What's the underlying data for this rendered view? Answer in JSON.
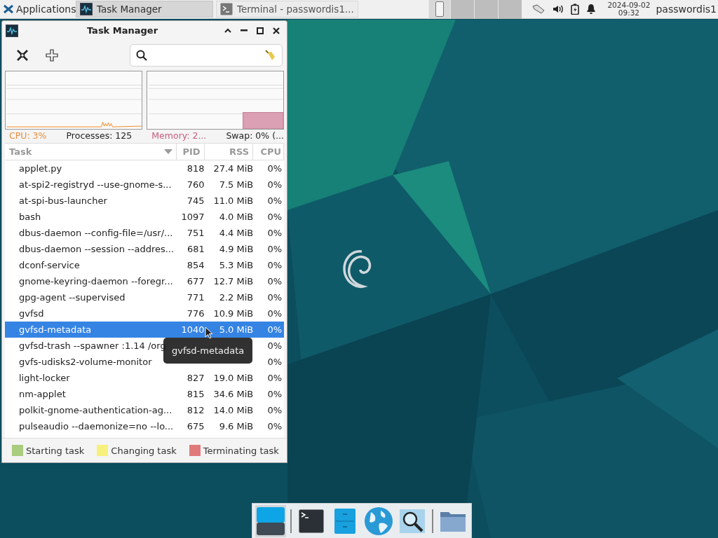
{
  "top_panel": {
    "applications_menu": "Applications",
    "tasks": [
      {
        "label": "Task Manager",
        "selected": true,
        "kind": "monitor"
      },
      {
        "label": "Terminal - passwordis1...",
        "selected": false,
        "kind": "terminal"
      }
    ],
    "clock": {
      "date": "2024-09-02",
      "time": "09:32"
    },
    "user": "passwordis1"
  },
  "window": {
    "title": "Task Manager"
  },
  "summary": {
    "cpu": "CPU: 3%",
    "processes": "Processes: 125",
    "memory": "Memory: 2...",
    "swap": "Swap: 0% (..."
  },
  "table": {
    "columns": [
      {
        "label": "Task",
        "sorted": true
      },
      {
        "label": "PID",
        "sorted": false
      },
      {
        "label": "RSS",
        "sorted": false
      },
      {
        "label": "CPU",
        "sorted": false
      }
    ],
    "rows": [
      {
        "task": "applet.py",
        "pid": "818",
        "rss": "27.4 MiB",
        "cpu": "0%",
        "selected": false
      },
      {
        "task": "at-spi2-registryd --use-gnome-s...",
        "pid": "760",
        "rss": "7.5 MiB",
        "cpu": "0%",
        "selected": false
      },
      {
        "task": "at-spi-bus-launcher",
        "pid": "745",
        "rss": "11.0 MiB",
        "cpu": "0%",
        "selected": false
      },
      {
        "task": "bash",
        "pid": "1097",
        "rss": "4.0 MiB",
        "cpu": "0%",
        "selected": false
      },
      {
        "task": "dbus-daemon --config-file=/usr/...",
        "pid": "751",
        "rss": "4.4 MiB",
        "cpu": "0%",
        "selected": false
      },
      {
        "task": "dbus-daemon --session --addres...",
        "pid": "681",
        "rss": "4.9 MiB",
        "cpu": "0%",
        "selected": false
      },
      {
        "task": "dconf-service",
        "pid": "854",
        "rss": "5.3 MiB",
        "cpu": "0%",
        "selected": false
      },
      {
        "task": "gnome-keyring-daemon --foregr...",
        "pid": "677",
        "rss": "12.7 MiB",
        "cpu": "0%",
        "selected": false
      },
      {
        "task": "gpg-agent --supervised",
        "pid": "771",
        "rss": "2.2 MiB",
        "cpu": "0%",
        "selected": false
      },
      {
        "task": "gvfsd",
        "pid": "776",
        "rss": "10.9 MiB",
        "cpu": "0%",
        "selected": false
      },
      {
        "task": "gvfsd-metadata",
        "pid": "1040",
        "rss": "5.0 MiB",
        "cpu": "0%",
        "selected": true
      },
      {
        "task": "gvfsd-trash --spawner :1.14 /org",
        "cpu": "0%",
        "selected": false
      },
      {
        "task": "gvfs-udisks2-volume-monitor",
        "cpu": "0%",
        "selected": false
      },
      {
        "task": "light-locker",
        "pid": "827",
        "rss": "19.0 MiB",
        "cpu": "0%",
        "selected": false
      },
      {
        "task": "nm-applet",
        "pid": "815",
        "rss": "34.6 MiB",
        "cpu": "0%",
        "selected": false
      },
      {
        "task": "polkit-gnome-authentication-ag...",
        "pid": "812",
        "rss": "14.0 MiB",
        "cpu": "0%",
        "selected": false
      },
      {
        "task": "pulseaudio --daemonize=no --lo...",
        "pid": "675",
        "rss": "9.6 MiB",
        "cpu": "0%",
        "selected": false
      }
    ]
  },
  "tooltip": "gvfsd-metadata",
  "legend": [
    {
      "label": "Starting task",
      "color": "#a9cc7e"
    },
    {
      "label": "Changing task",
      "color": "#f7f07c"
    },
    {
      "label": "Terminating task",
      "color": "#e07a7a"
    }
  ],
  "dock": {
    "items": [
      {
        "kind": "desktop"
      },
      {
        "kind": "separator"
      },
      {
        "kind": "terminal"
      },
      {
        "kind": "cabinet"
      },
      {
        "kind": "globe"
      },
      {
        "kind": "magnifier"
      },
      {
        "kind": "separator"
      },
      {
        "kind": "folder"
      }
    ]
  }
}
